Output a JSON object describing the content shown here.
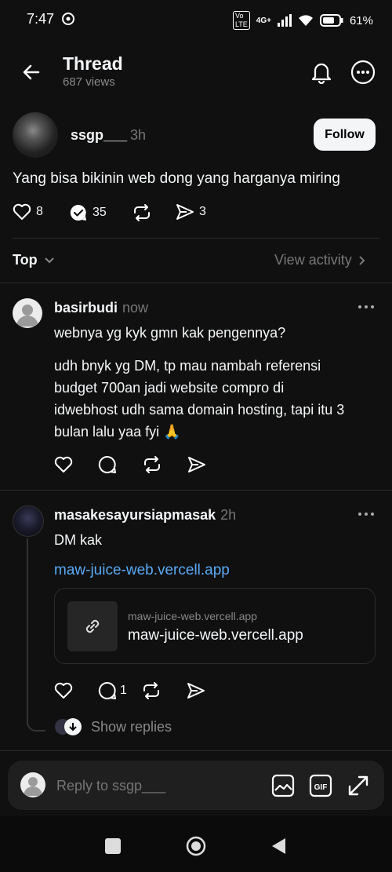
{
  "status": {
    "time": "7:47",
    "battery": "61%",
    "network": "4G+"
  },
  "header": {
    "title": "Thread",
    "views": "687 views"
  },
  "post": {
    "username": "ssgp___",
    "time": "3h",
    "follow_label": "Follow",
    "text": "Yang bisa bikinin web dong yang harganya miring",
    "likes": "8",
    "replies": "35",
    "shares": "3"
  },
  "sort": {
    "label": "Top",
    "activity_label": "View activity"
  },
  "comments": [
    {
      "username": "basirbudi",
      "time": "now",
      "paragraph1": "webnya yg kyk gmn kak pengennya?",
      "paragraph2": [
        "udh bnyk yg DM, tp mau nambah referensi",
        "budget 700an jadi website compro di",
        "idwebhost udh sama domain hosting, tapi itu 3",
        "bulan lalu yaa fyi 🙏"
      ]
    },
    {
      "username": "masakesayursiapmasak",
      "time": "2h",
      "text": "DM kak",
      "link": "maw-juice-web.vercell.app",
      "card_domain": "maw-juice-web.vercell.app",
      "card_title": "maw-juice-web.vercell.app",
      "reply_count": "1",
      "show_replies": "Show replies"
    }
  ],
  "reply_input": {
    "placeholder": "Reply to ssgp___"
  }
}
